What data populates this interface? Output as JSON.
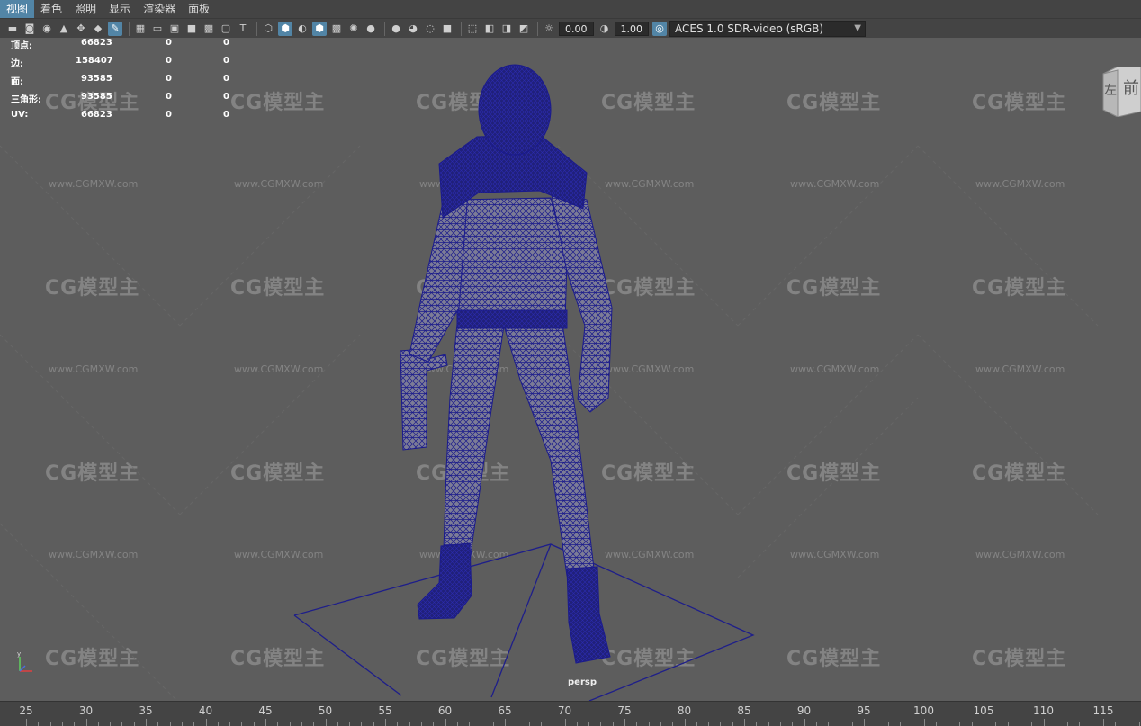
{
  "menu": {
    "items": [
      "视图",
      "着色",
      "照明",
      "显示",
      "渲染器",
      "面板"
    ],
    "active_index": 0
  },
  "toolbar": {
    "exposure_value": "0.00",
    "gamma_value": "1.00",
    "color_space": "ACES 1.0 SDR-video (sRGB)"
  },
  "hud": {
    "rows": [
      {
        "label": "顶点:",
        "value": "66823",
        "c2": "0",
        "c3": "0"
      },
      {
        "label": "边:",
        "value": "158407",
        "c2": "0",
        "c3": "0"
      },
      {
        "label": "面:",
        "value": "93585",
        "c2": "0",
        "c3": "0"
      },
      {
        "label": "三角形:",
        "value": "93585",
        "c2": "0",
        "c3": "0"
      },
      {
        "label": "UV:",
        "value": "66823",
        "c2": "0",
        "c3": "0"
      }
    ]
  },
  "viewcube": {
    "front_label": "前",
    "left_label": "左"
  },
  "camera_label": "persp",
  "watermark": {
    "brand": "CG模型主",
    "url": "www.CGMXW.com"
  },
  "timeline": {
    "ticks": [
      "25",
      "30",
      "35",
      "40",
      "45",
      "50",
      "55",
      "60",
      "65",
      "70",
      "75",
      "80",
      "85",
      "90",
      "95",
      "100",
      "105",
      "110",
      "115"
    ]
  },
  "colors": {
    "wireframe": "#1a1a8c",
    "accent": "#5285a6",
    "viewport_bg": "#5d5d5d"
  }
}
